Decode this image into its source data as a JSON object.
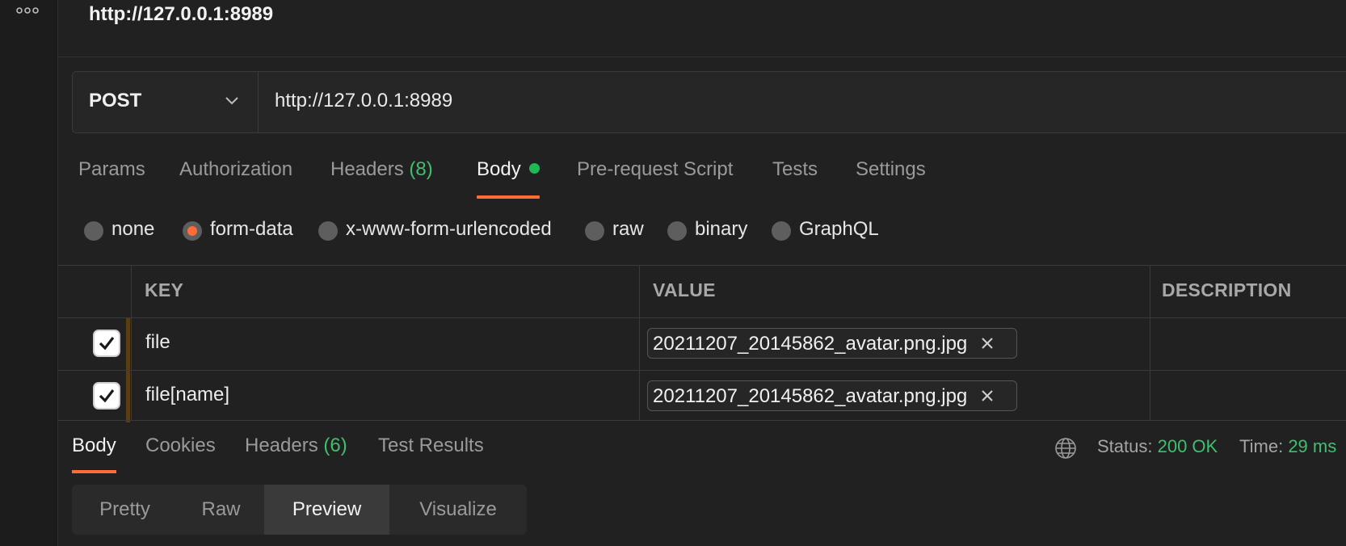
{
  "request": {
    "title": "http://127.0.0.1:8989",
    "method": "POST",
    "url": "http://127.0.0.1:8989"
  },
  "request_tabs": [
    {
      "label": "Params"
    },
    {
      "label": "Authorization"
    },
    {
      "label": "Headers",
      "count": "(8)"
    },
    {
      "label": "Body"
    },
    {
      "label": "Pre-request Script"
    },
    {
      "label": "Tests"
    },
    {
      "label": "Settings"
    }
  ],
  "body_types": [
    {
      "label": "none",
      "checked": false
    },
    {
      "label": "form-data",
      "checked": true
    },
    {
      "label": "x-www-form-urlencoded",
      "checked": false
    },
    {
      "label": "raw",
      "checked": false
    },
    {
      "label": "binary",
      "checked": false
    },
    {
      "label": "GraphQL",
      "checked": false
    }
  ],
  "form_table": {
    "headers": {
      "key": "KEY",
      "value": "VALUE",
      "description": "DESCRIPTION"
    },
    "rows": [
      {
        "checked": true,
        "key": "file",
        "value": "20211207_20145862_avatar.png.jpg",
        "description": ""
      },
      {
        "checked": true,
        "key": "file[name]",
        "value": "20211207_20145862_avatar.png.jpg",
        "description": ""
      }
    ]
  },
  "response_tabs": [
    {
      "label": "Body"
    },
    {
      "label": "Cookies"
    },
    {
      "label": "Headers",
      "count": "(6)"
    },
    {
      "label": "Test Results"
    }
  ],
  "response_status": {
    "status_label": "Status:",
    "status_value": "200 OK",
    "time_label": "Time:",
    "time_value": "29 ms"
  },
  "view_modes": [
    {
      "label": "Pretty"
    },
    {
      "label": "Raw"
    },
    {
      "label": "Preview"
    },
    {
      "label": "Visualize"
    }
  ],
  "colors": {
    "accent": "#ff6c37",
    "success": "#3fbf6f",
    "background": "#212121"
  },
  "icons": [
    "more-icon",
    "chevron-down-icon",
    "checkbox-icon",
    "close-icon",
    "globe-icon"
  ]
}
